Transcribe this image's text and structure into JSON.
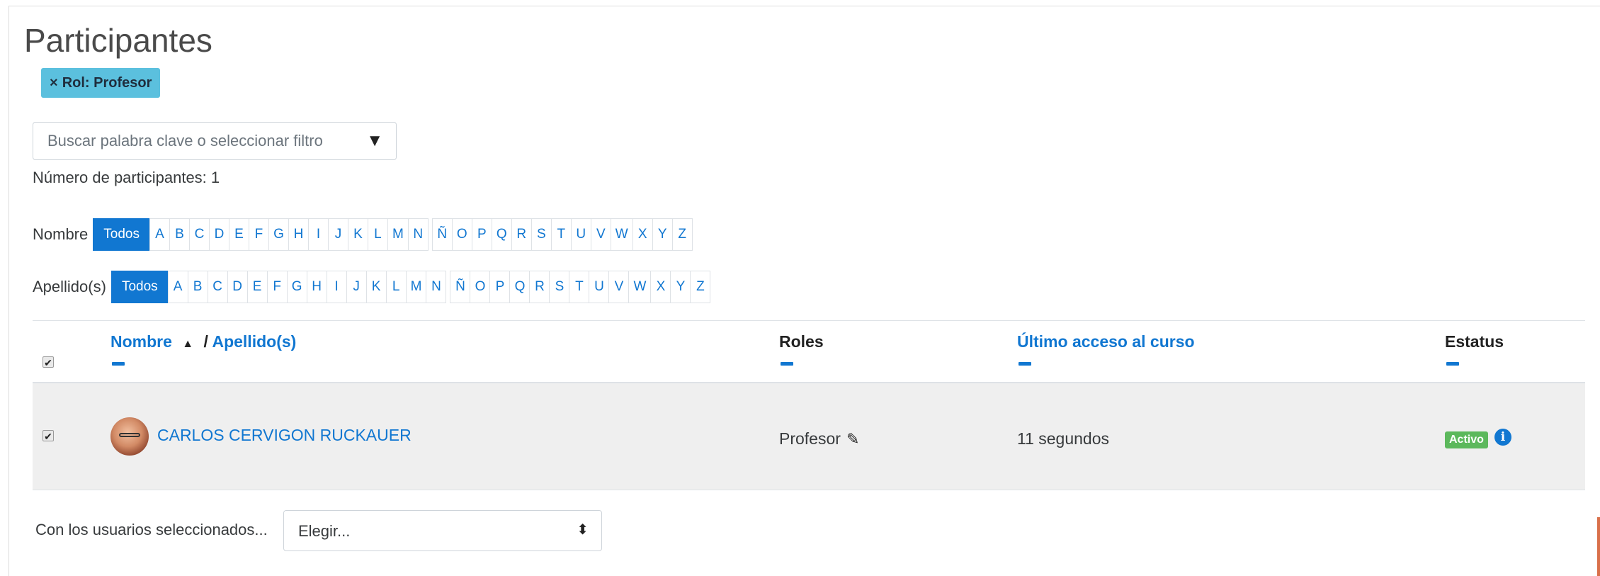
{
  "page": {
    "title": "Participantes"
  },
  "filter_chip": {
    "close": "×",
    "label": "Rol: Profesor"
  },
  "search": {
    "placeholder": "Buscar palabra clave o seleccionar filtro",
    "caret": "▼"
  },
  "count_text": "Número de participantes: 1",
  "first_name_bar": {
    "label": "Nombre",
    "all": "Todos",
    "letters": [
      "A",
      "B",
      "C",
      "D",
      "E",
      "F",
      "G",
      "H",
      "I",
      "J",
      "K",
      "L",
      "M",
      "N",
      "Ñ",
      "O",
      "P",
      "Q",
      "R",
      "S",
      "T",
      "U",
      "V",
      "W",
      "X",
      "Y",
      "Z"
    ]
  },
  "last_name_bar": {
    "label": "Apellido(s)",
    "all": "Todos",
    "letters": [
      "A",
      "B",
      "C",
      "D",
      "E",
      "F",
      "G",
      "H",
      "I",
      "J",
      "K",
      "L",
      "M",
      "N",
      "Ñ",
      "O",
      "P",
      "Q",
      "R",
      "S",
      "T",
      "U",
      "V",
      "W",
      "X",
      "Y",
      "Z"
    ]
  },
  "table": {
    "headers": {
      "first_name": "Nombre",
      "sort_indicator": "▲",
      "separator": "/",
      "last_name": "Apellido(s)",
      "roles": "Roles",
      "last_access": "Último acceso al curso",
      "status": "Estatus"
    },
    "rows": [
      {
        "name": "CARLOS CERVIGON RUCKAUER",
        "role": "Profesor",
        "last_access": "11 segundos",
        "status": "Activo",
        "info": "i",
        "checked": true
      }
    ]
  },
  "bulk": {
    "label": "Con los usuarios seleccionados...",
    "selected": "Elegir...",
    "arrows": "⬍"
  },
  "icons": {
    "edit": "pencil-icon",
    "info": "info-icon",
    "sort": "sort-asc-icon"
  },
  "colors": {
    "link": "#1177d1",
    "chip": "#5bc0de",
    "active_badge": "#5cb85c",
    "row_bg": "#efefef"
  }
}
